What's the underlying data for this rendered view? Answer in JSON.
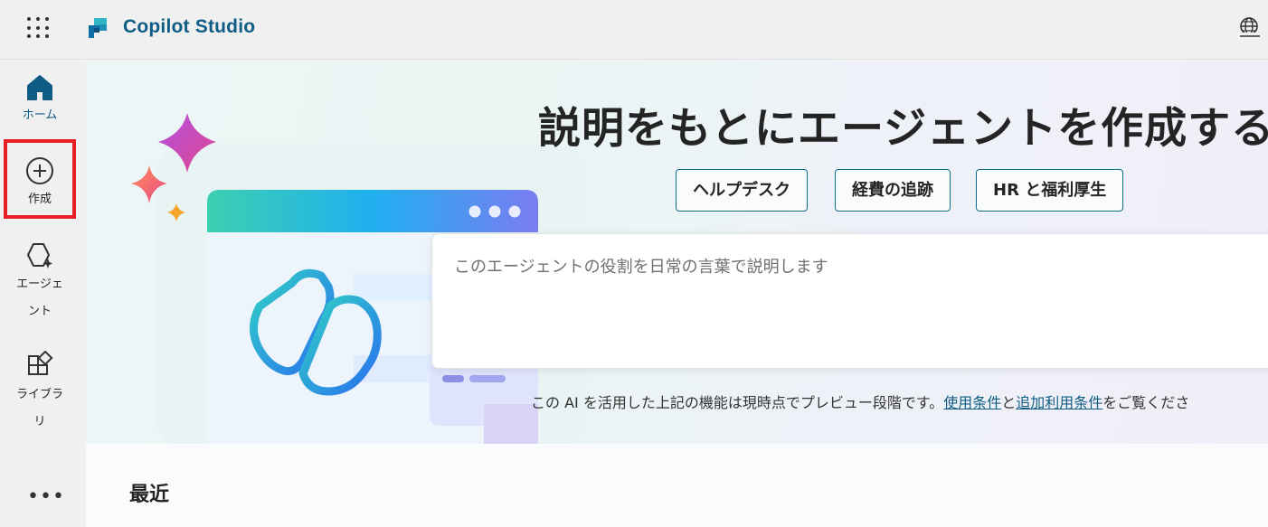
{
  "app": {
    "title": "Copilot Studio"
  },
  "nav": {
    "items": [
      {
        "id": "home",
        "label": "ホーム",
        "icon": "home-icon"
      },
      {
        "id": "create",
        "label": "作成",
        "icon": "add-circle-icon"
      },
      {
        "id": "agents",
        "label": "エージェント",
        "icon": "agent-icon"
      },
      {
        "id": "library",
        "label": "ライブラリ",
        "icon": "apps-add-icon"
      }
    ],
    "more": "•••"
  },
  "hero": {
    "title": "説明をもとにエージェントを作成する",
    "chips": [
      "ヘルプデスク",
      "経費の追跡",
      "HR と福利厚生"
    ],
    "prompt_placeholder": "このエージェントの役割を日常の言葉で説明します",
    "disclaimer": {
      "prefix": "この AI を活用した上記の機能は現時点でプレビュー段階です。",
      "link1": "使用条件",
      "joiner": "と",
      "link2": "追加利用条件",
      "suffix": "をご覧くださ"
    }
  },
  "recent": {
    "heading": "最近"
  },
  "colors": {
    "brand": "#0f5c85",
    "highlight": "#e61e25"
  }
}
